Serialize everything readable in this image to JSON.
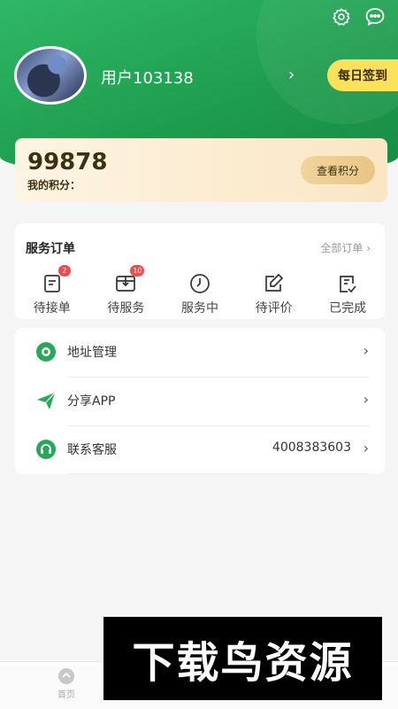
{
  "header": {
    "username": "用户103138",
    "checkin_label": "每日签到",
    "icons": [
      "settings-icon",
      "message-icon"
    ]
  },
  "points": {
    "value": "99878",
    "label": "我的积分：",
    "button_label": "查看积分"
  },
  "orders": {
    "title": "服务订单",
    "all_label": "全部订单",
    "items": [
      {
        "label": "待接单",
        "icon": "pending-order-icon",
        "badge": "2"
      },
      {
        "label": "待服务",
        "icon": "to-serve-icon",
        "badge": "10"
      },
      {
        "label": "服务中",
        "icon": "in-service-clock-icon",
        "badge": ""
      },
      {
        "label": "待评价",
        "icon": "to-review-edit-icon",
        "badge": ""
      },
      {
        "label": "已完成",
        "icon": "completed-check-icon",
        "badge": ""
      }
    ]
  },
  "menu": {
    "items": [
      {
        "label": "地址管理",
        "value": "",
        "icon": "location-icon"
      },
      {
        "label": "分享APP",
        "value": "",
        "icon": "share-paper-plane-icon"
      },
      {
        "label": "联系客服",
        "value": "4008383603",
        "icon": "customer-service-icon"
      }
    ]
  },
  "tabbar": {
    "home_label": "首页"
  },
  "watermark": {
    "text": "下载鸟资源"
  },
  "colors": {
    "primary_green": "#1f9e4f",
    "checkin_yellow": "#fce15b",
    "points_card_bg": "#fae6c4",
    "badge_red": "#f24a4a"
  }
}
